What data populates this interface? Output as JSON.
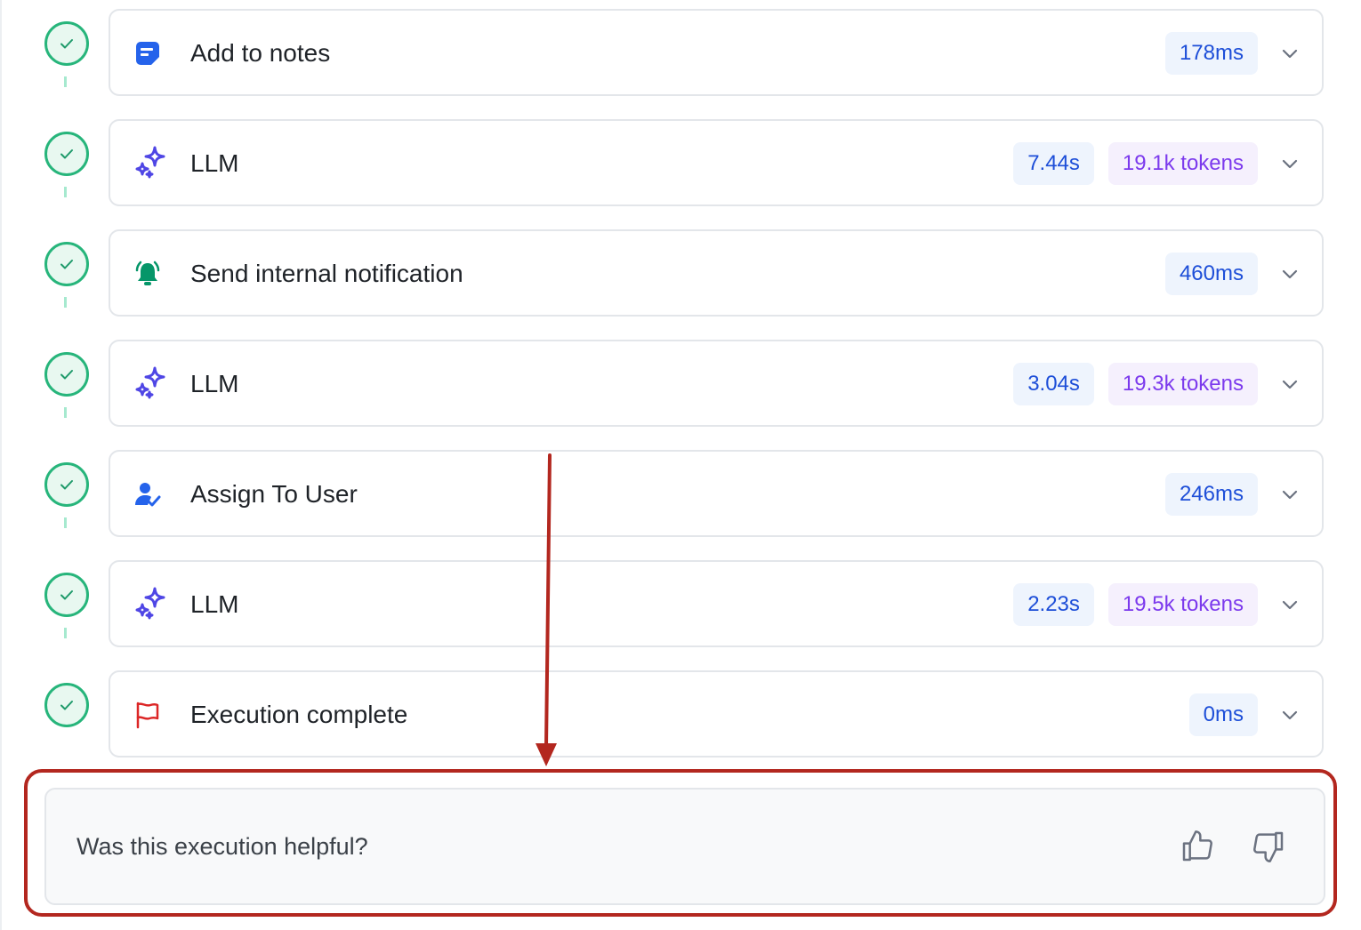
{
  "steps": [
    {
      "icon": "notes-icon",
      "title": "Add to notes",
      "duration": "178ms",
      "tokens": null
    },
    {
      "icon": "sparkles-icon",
      "title": "LLM",
      "duration": "7.44s",
      "tokens": "19.1k tokens"
    },
    {
      "icon": "bell-icon",
      "title": "Send internal notification",
      "duration": "460ms",
      "tokens": null
    },
    {
      "icon": "sparkles-icon",
      "title": "LLM",
      "duration": "3.04s",
      "tokens": "19.3k tokens"
    },
    {
      "icon": "assign-user-icon",
      "title": "Assign To User",
      "duration": "246ms",
      "tokens": null
    },
    {
      "icon": "sparkles-icon",
      "title": "LLM",
      "duration": "2.23s",
      "tokens": "19.5k tokens"
    },
    {
      "icon": "flag-icon",
      "title": "Execution complete",
      "duration": "0ms",
      "tokens": null
    }
  ],
  "feedback": {
    "question": "Was this execution helpful?",
    "up_icon": "thumbs-up-icon",
    "down_icon": "thumbs-down-icon"
  },
  "colors": {
    "success": "#27b57b",
    "annotation": "#b3271f",
    "time_badge": "#1d4ed8",
    "token_badge": "#7c3aed"
  }
}
